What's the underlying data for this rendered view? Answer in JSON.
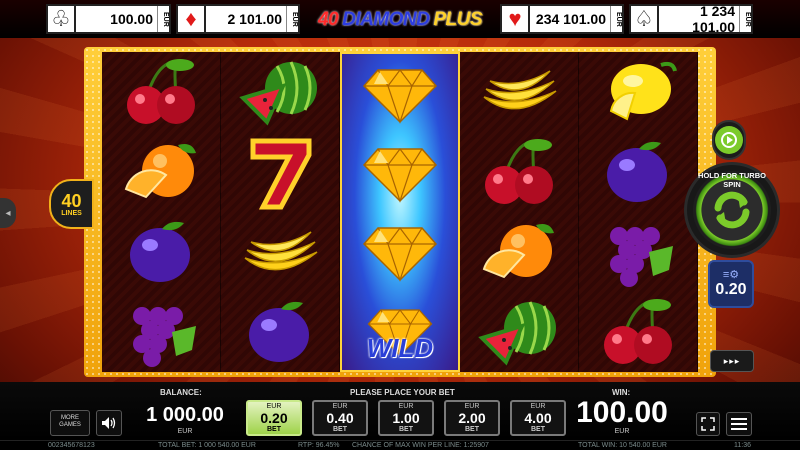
{
  "jackpots": [
    {
      "suit": "clubs",
      "symbol": "♧",
      "value": "100.00",
      "currency": "EUR"
    },
    {
      "suit": "diamonds",
      "symbol": "♦",
      "value": "2 101.00",
      "currency": "EUR"
    },
    {
      "suit": "hearts",
      "symbol": "♥",
      "value": "234 101.00",
      "currency": "EUR"
    },
    {
      "suit": "spades",
      "symbol": "♤",
      "value": "1 234 101.00",
      "currency": "EUR"
    }
  ],
  "logo": {
    "part1": "40",
    "part2": "DIAMOND",
    "part3": "PLUS"
  },
  "lines": {
    "count": "40",
    "label": "LINES"
  },
  "reels": [
    [
      "cherry",
      "orange",
      "plum",
      "grapes"
    ],
    [
      "watermelon",
      "seven",
      "banana",
      "plum"
    ],
    [
      "diamond",
      "diamond",
      "diamond",
      "wild"
    ],
    [
      "banana",
      "cherry",
      "orange",
      "watermelon"
    ],
    [
      "lemon",
      "plum",
      "grapes",
      "cherry"
    ]
  ],
  "wild_label": "WILD",
  "controls": {
    "turbo_label": "HOLD FOR TURBO SPIN",
    "stake_value": "0.20",
    "ffwd_label": "▸▸▸"
  },
  "bottom": {
    "balance_label": "BALANCE:",
    "balance_value": "1 000.00",
    "balance_currency": "EUR",
    "bet_prompt": "PLEASE PLACE YOUR BET",
    "win_label": "WIN:",
    "win_value": "100.00",
    "win_currency": "EUR",
    "more_games": "MORE GAMES",
    "bets": [
      {
        "currency": "EUR",
        "value": "0.20",
        "label": "BET",
        "selected": true
      },
      {
        "currency": "EUR",
        "value": "0.40",
        "label": "BET",
        "selected": false
      },
      {
        "currency": "EUR",
        "value": "1.00",
        "label": "BET",
        "selected": false
      },
      {
        "currency": "EUR",
        "value": "2.00",
        "label": "BET",
        "selected": false
      },
      {
        "currency": "EUR",
        "value": "4.00",
        "label": "BET",
        "selected": false
      }
    ]
  },
  "status": {
    "id": "002345678123",
    "total_bet": "TOTAL BET: 1 000 540.00 EUR",
    "rtp": "RTP: 96.45%",
    "chance": "CHANCE OF MAX WIN PER LINE: 1:25907",
    "total_win": "TOTAL WIN: 10 540.00 EUR",
    "time": "11:36"
  },
  "colors": {
    "frame": "#f5b01a",
    "spin_green": "#7ccb2a",
    "selected_bet": "#9fd34a",
    "background": "#c0300c"
  }
}
